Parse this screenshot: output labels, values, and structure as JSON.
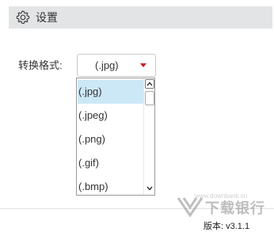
{
  "header": {
    "title": "设置",
    "icon": "gear-icon"
  },
  "format": {
    "label": "转换格式:",
    "selected": "(.jpg)"
  },
  "dropdown": {
    "options": [
      "(.jpg)",
      "(.jpeg)",
      "(.png)",
      "(.gif)",
      "(.bmp)"
    ],
    "selected_index": 0
  },
  "footer": {
    "version": "版本: v3.1.1"
  },
  "watermark": {
    "text": "下载银行",
    "url": "www.downbank.cn"
  },
  "colors": {
    "header_bg": "#e3e4e6",
    "selected_bg": "#cce8f7",
    "arrow": "#c81e1e"
  }
}
